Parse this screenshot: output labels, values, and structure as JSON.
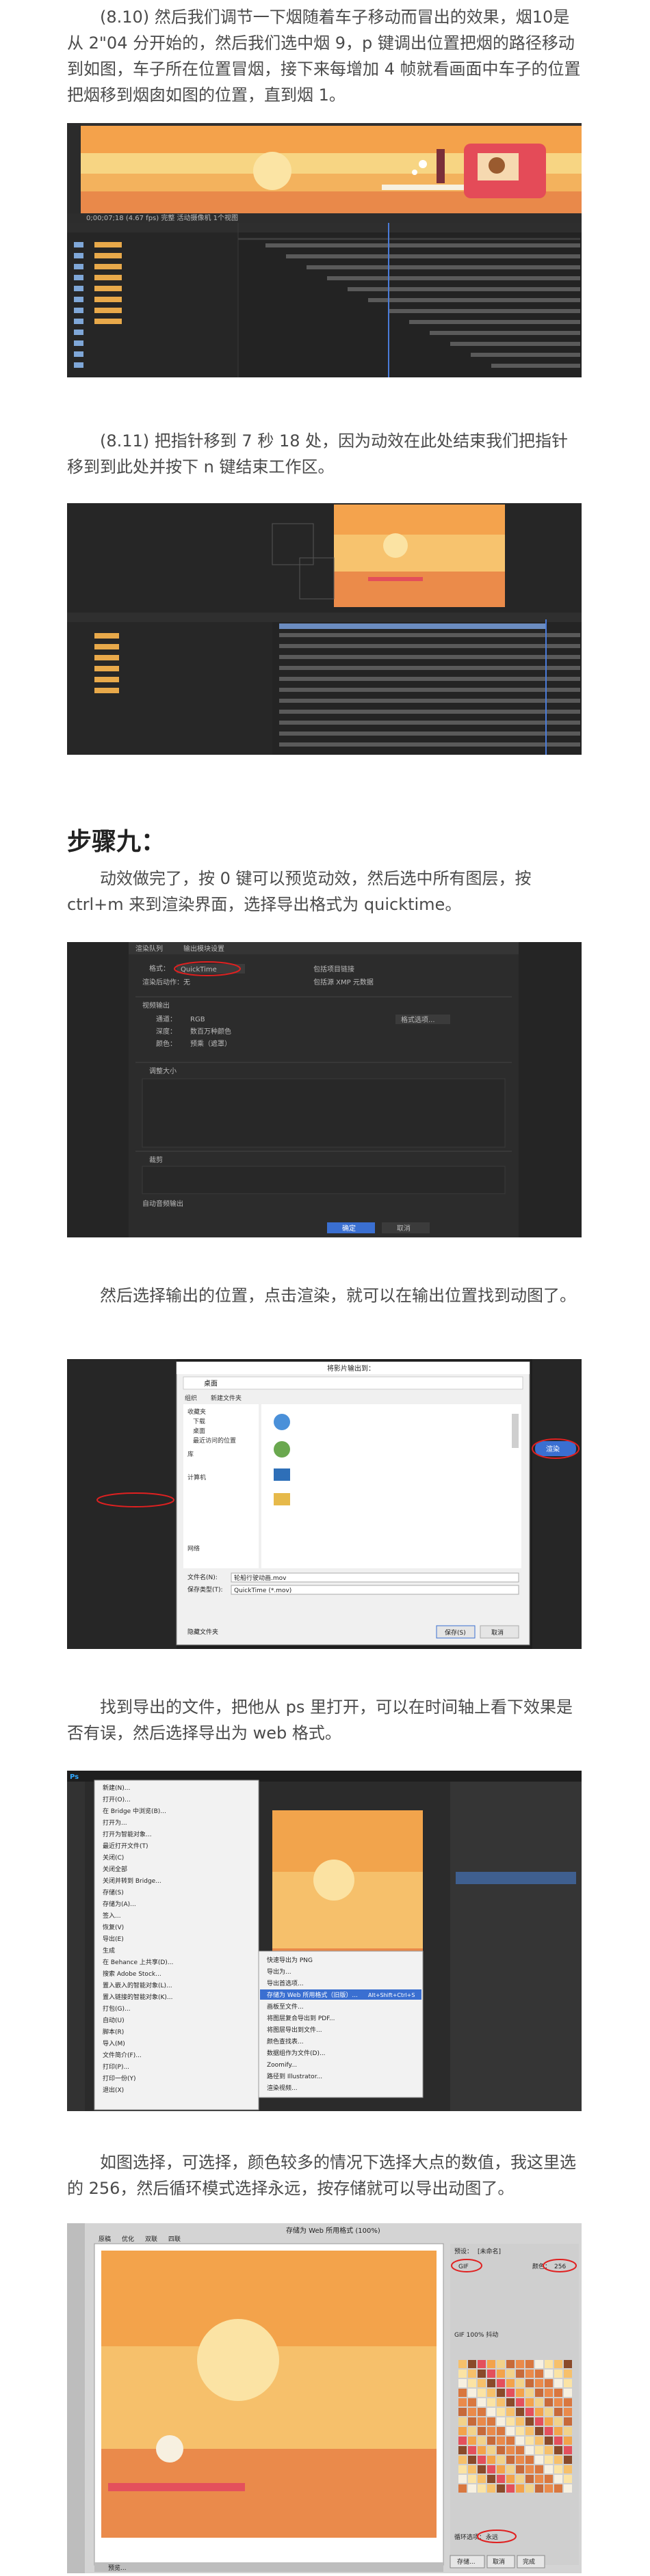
{
  "paragraphs": {
    "p1": "(8.10) 然后我们调节一下烟随着车子移动而冒出的效果，烟10是从 2\"04 分开始的，然后我们选中烟 9，p 键调出位置把烟的路径移动到如图，车子所在位置冒烟，接下来每增加 4 帧就看画面中车子的位置把烟移到烟囱如图的位置，直到烟 1。",
    "p2": "(8.11) 把指针移到 7 秒 18 处，因为动效在此处结束我们把指针移到到此处并按下 n 键结束工作区。",
    "heading": "步骤九：",
    "p3": "动效做完了，按 0 键可以预览动效，然后选中所有图层，按ctrl+m 来到渲染界面，选择导出格式为 quicktime。",
    "p4": "然后选择输出的位置，点击渲染，就可以在输出位置找到动图了。",
    "p5": "找到导出的文件，把他从 ps 里打开，可以在时间轴上看下效果是否有误，然后选择导出为 web 格式。",
    "p6": "如图选择，可选择，颜色较多的情况下选择大点的数值，我这里选的 256，然后循环模式选择永远，按存储就可以导出动图了。"
  },
  "screens": {
    "render": {
      "tab_render_queue": "渲染队列",
      "tab_output_module": "输出模块设置",
      "format_label": "格式：",
      "format_value": "QuickTime",
      "include_project_link": "包括项目链接",
      "post_render_label": "渲染后动作：",
      "post_render_value": "无",
      "include_source_xmp": "包括源 XMP 元数据",
      "video_output": "视频输出",
      "format_options_button": "格式选项...",
      "channels_label": "通道：",
      "channels_value": "RGB",
      "depth_label": "深度：",
      "depth_value": "数百万种颜色",
      "color_label": "颜色：",
      "color_value": "预乘（遮罩）",
      "resize_label": "调整大小",
      "crop_label": "裁剪",
      "auto_audio": "自动音频输出",
      "ok_button": "确定",
      "cancel_button": "取消"
    },
    "save_dialog": {
      "title": "将影片输出到：",
      "location": "桌面",
      "organize": "组织",
      "new_folder": "新建文件夹",
      "favorites": "收藏夹",
      "downloads": "下载",
      "desktop": "桌面",
      "recent": "最近访问的位置",
      "libraries": "库",
      "computer": "计算机",
      "network": "网络",
      "file_name_label": "文件名(N):",
      "file_name_value": "轮船行驶动画.mov",
      "save_type_label": "保存类型(T):",
      "save_type_value": "QuickTime (*.mov)",
      "save_button": "保存(S)",
      "cancel_button": "取消",
      "hide_folders": "隐藏文件夹",
      "render_button": "渲染"
    },
    "ps_menu": {
      "app_logo": "Ps",
      "items": [
        "新建(N)...",
        "打开(O)...",
        "在 Bridge 中浏览(B)...",
        "打开为...",
        "打开为智能对象...",
        "最近打开文件(T)",
        "关闭(C)",
        "关闭全部",
        "关闭并转到 Bridge...",
        "存储(S)",
        "存储为(A)...",
        "签入...",
        "恢复(V)",
        "导出(E)",
        "生成",
        "在 Behance 上共享(D)...",
        "搜索 Adobe Stock...",
        "置入嵌入的智能对象(L)...",
        "置入链接的智能对象(K)...",
        "打包(G)...",
        "自动(U)",
        "脚本(R)",
        "导入(M)",
        "文件简介(F)...",
        "打印(P)...",
        "打印一份(Y)",
        "退出(X)"
      ],
      "export_submenu": [
        "快速导出为 PNG",
        "导出为...",
        "导出首选项...",
        "存储为 Web 所用格式（旧版）...",
        "画板至文件...",
        "将图层复合导出到 PDF...",
        "将图层导出到文件...",
        "颜色查找表...",
        "数据组作为文件(D)...",
        "Zoomify...",
        "路径到 Illustrator...",
        "渲染视频..."
      ],
      "highlighted": "存储为 Web 所用格式（旧版）...",
      "shortcut": "Alt+Shift+Ctrl+S"
    },
    "web_save": {
      "title": "存储为 Web 所用格式 (100%)",
      "tabs": [
        "原稿",
        "优化",
        "双联",
        "四联"
      ],
      "preset_label": "预设：",
      "preset_value": "[未命名]",
      "format_value": "GIF",
      "colors_label": "颜色：",
      "colors_value": "256",
      "loop_label": "循环选项：",
      "loop_value": "永远",
      "info": "GIF 100% 抖动",
      "save_button": "存储...",
      "cancel_button": "取消",
      "done_button": "完成",
      "preview_button": "预览..."
    }
  }
}
